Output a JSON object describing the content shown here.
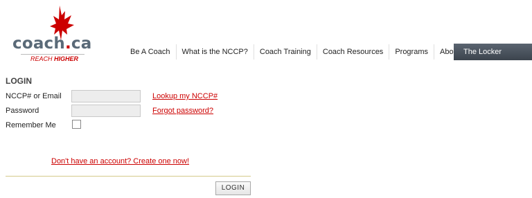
{
  "brand": {
    "name_part1": "coach",
    "name_dot": ".",
    "name_part2": "ca",
    "tagline_plain": "REACH ",
    "tagline_bold": "HIGHER",
    "brand_red": "#cc0000"
  },
  "nav": {
    "items": [
      "Be A Coach",
      "What is the NCCP?",
      "Coach Training",
      "Coach Resources",
      "Programs",
      "About CAC"
    ],
    "locker": "The Locker"
  },
  "login": {
    "title": "LOGIN",
    "nccp_label": "NCCP# or Email",
    "nccp_value": "",
    "password_label": "Password",
    "password_value": "",
    "remember_label": "Remember Me",
    "remember_checked": false,
    "lookup_link": "Lookup my NCCP#",
    "forgot_link": "Forgot password?",
    "create_link": "Don't have an account? Create one now!",
    "button": "LOGIN"
  },
  "icons": {
    "logo": "maple-leaf-flame-icon"
  }
}
